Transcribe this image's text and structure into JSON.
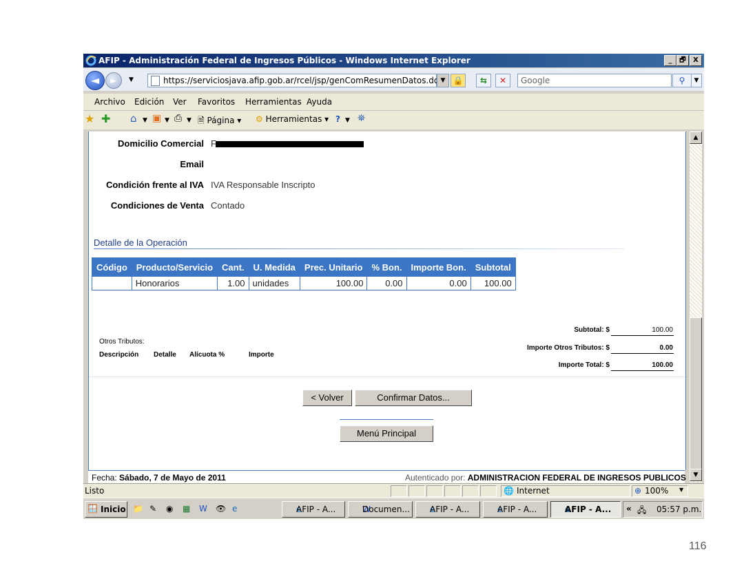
{
  "window": {
    "title": "AFIP - Administración Federal de Ingresos Públicos - Windows Internet Explorer",
    "controls": [
      "_",
      "🗗",
      "X"
    ]
  },
  "address_bar": {
    "url": "https://serviciosjava.afip.gob.ar/rcel/jsp/genComResumenDatos.do",
    "search_placeholder": "Google"
  },
  "menu": [
    "Archivo",
    "Edición",
    "Ver",
    "Favoritos",
    "Herramientas",
    "Ayuda"
  ],
  "command_bar": {
    "page_label": "Página",
    "tools_label": "Herramientas"
  },
  "fields": {
    "domicilio_label": "Domicilio Comercial",
    "domicilio_value": "F",
    "email_label": "Email",
    "email_value": "",
    "iva_label": "Condición frente al IVA",
    "iva_value": "IVA Responsable Inscripto",
    "venta_label": "Condiciones de Venta",
    "venta_value": "Contado"
  },
  "operation": {
    "section_title": "Detalle de la Operación",
    "columns": [
      "Código",
      "Producto/Servicio",
      "Cant.",
      "U. Medida",
      "Prec. Unitario",
      "% Bon.",
      "Importe Bon.",
      "Subtotal"
    ],
    "rows": [
      [
        "",
        "Honorarios",
        "1.00",
        "unidades",
        "100.00",
        "0.00",
        "0.00",
        "100.00"
      ]
    ]
  },
  "otros_tributos": {
    "title": "Otros Tributos:",
    "columns": [
      "Descripción",
      "Detalle",
      "Alícuota %",
      "Importe"
    ]
  },
  "totals": {
    "subtotal_label": "Subtotal: $",
    "subtotal_value": "100.00",
    "otros_label": "Importe Otros Tributos: $",
    "otros_value": "0.00",
    "total_label": "Importe Total: $",
    "total_value": "100.00"
  },
  "buttons": {
    "volver": "< Volver",
    "confirmar": "Confirmar Datos...",
    "menu_principal": "Menú Principal"
  },
  "page_footer": {
    "fecha_prefix": "Fecha: ",
    "fecha_value": "Sábado, 7 de Mayo de 2011",
    "auth_prefix": "Autenticado por: ",
    "auth_value": "ADMINISTRACION FEDERAL DE INGRESOS PUBLICOS"
  },
  "status_bar": {
    "status": "Listo",
    "zone": "Internet",
    "zoom": "100%"
  },
  "taskbar": {
    "start": "Inicio",
    "tasks": [
      "AFIP - A...",
      "Documen...",
      "AFIP - A...",
      "AFIP - A...",
      "AFIP - A..."
    ],
    "clock": "05:57 p.m."
  },
  "slide_number": "116",
  "colors": {
    "table_header": "#3b75c4",
    "title_bar": "#0a246a",
    "section_title": "#1e3c8c"
  }
}
